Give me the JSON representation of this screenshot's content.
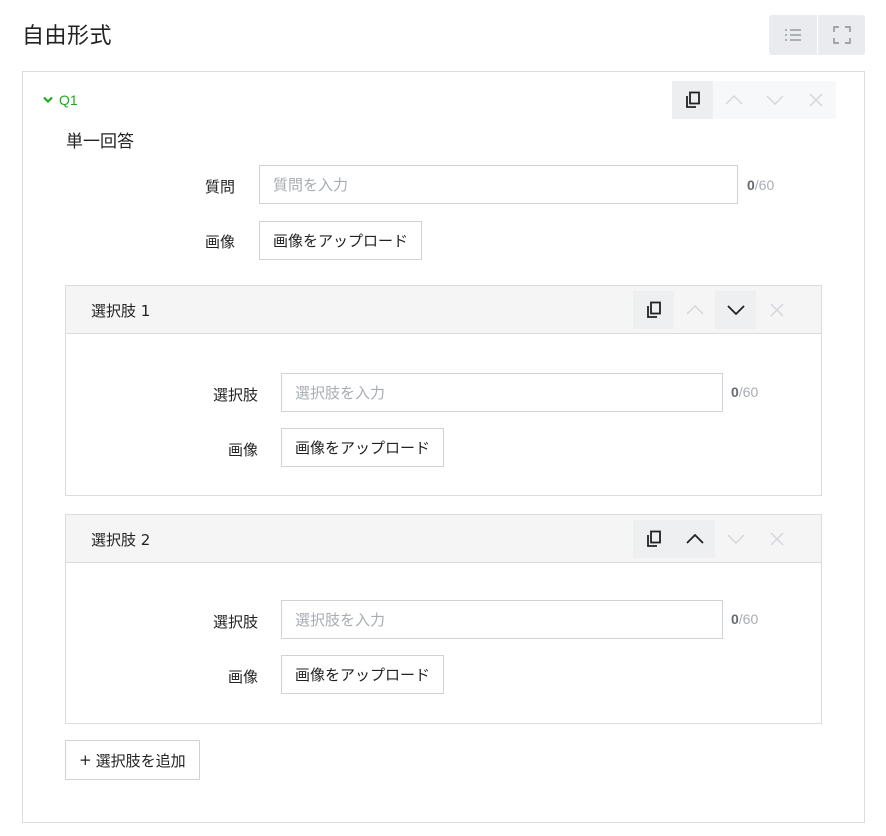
{
  "page": {
    "title": "自由形式"
  },
  "view_toggle": {
    "list_icon": "list-icon",
    "fullscreen_icon": "fullscreen-icon"
  },
  "question": {
    "label": "Q1",
    "type_label": "単一回答",
    "question_field": {
      "label": "質問",
      "placeholder": "質問を入力",
      "value": "",
      "count": "0",
      "max": "/60"
    },
    "image_field": {
      "label": "画像",
      "upload_label": "画像をアップロード"
    }
  },
  "choices": [
    {
      "title": "選択肢 1",
      "choice_field": {
        "label": "選択肢",
        "placeholder": "選択肢を入力",
        "value": "",
        "count": "0",
        "max": "/60"
      },
      "image_field": {
        "label": "画像",
        "upload_label": "画像をアップロード"
      }
    },
    {
      "title": "選択肢 2",
      "choice_field": {
        "label": "選択肢",
        "placeholder": "選択肢を入力",
        "value": "",
        "count": "0",
        "max": "/60"
      },
      "image_field": {
        "label": "画像",
        "upload_label": "画像をアップロード"
      }
    }
  ],
  "add_choice": {
    "icon": "+",
    "label": "選択肢を追加"
  },
  "colors": {
    "accent_green": "#1aad19",
    "border": "#dcdcdc",
    "muted": "#a8adb3",
    "header_bg": "#f5f5f5"
  }
}
